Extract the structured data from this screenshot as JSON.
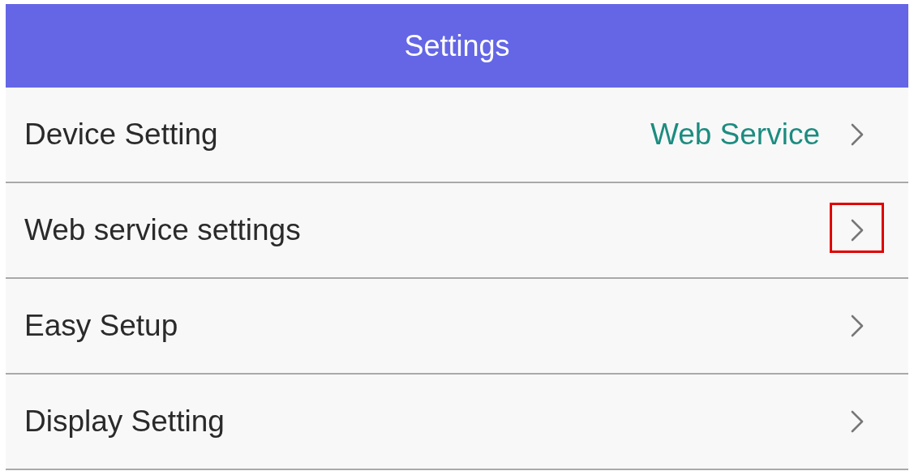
{
  "header": {
    "title": "Settings"
  },
  "items": [
    {
      "label": "Device Setting",
      "value": "Web Service",
      "highlighted": false
    },
    {
      "label": "Web service settings",
      "highlighted": true
    },
    {
      "label": "Easy Setup",
      "highlighted": false
    },
    {
      "label": "Display Setting",
      "highlighted": false
    }
  ]
}
